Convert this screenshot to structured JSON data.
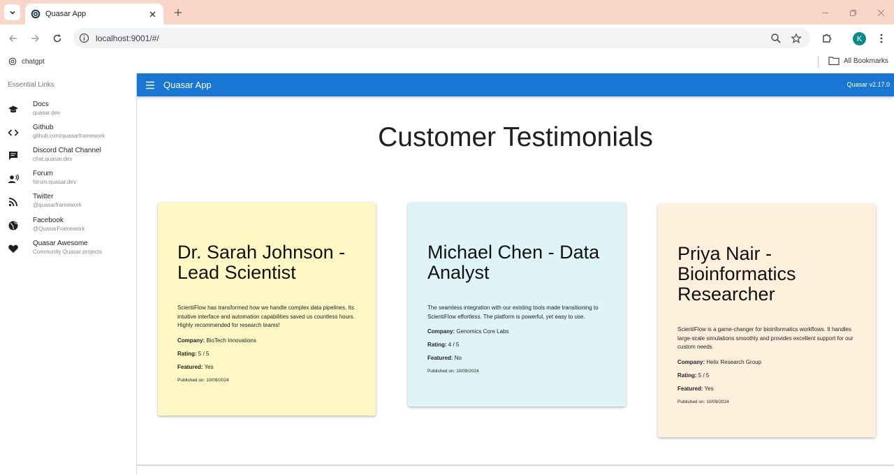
{
  "browser": {
    "tab_title": "Quasar App",
    "url": "localhost:9001/#/",
    "profile_initial": "K",
    "bookmarks": [
      {
        "label": "chatgpt"
      }
    ],
    "all_bookmarks_label": "All Bookmarks"
  },
  "drawer": {
    "header": "Essential Links",
    "links": [
      {
        "title": "Docs",
        "caption": "quasar.dev",
        "icon": "school-icon"
      },
      {
        "title": "Github",
        "caption": "github.com/quasarframework",
        "icon": "code-icon"
      },
      {
        "title": "Discord Chat Channel",
        "caption": "chat.quasar.dev",
        "icon": "chat-icon"
      },
      {
        "title": "Forum",
        "caption": "forum.quasar.dev",
        "icon": "record-voice-icon"
      },
      {
        "title": "Twitter",
        "caption": "@quasarframework",
        "icon": "rss-feed-icon"
      },
      {
        "title": "Facebook",
        "caption": "@QuasarFramework",
        "icon": "public-icon"
      },
      {
        "title": "Quasar Awesome",
        "caption": "Community Quasar projects",
        "icon": "favorite-icon"
      }
    ]
  },
  "header": {
    "title": "Quasar App",
    "version": "Quasar v2.17.0",
    "color": "#1976d2"
  },
  "page": {
    "heading": "Customer Testimonials"
  },
  "labels": {
    "company": "Company:",
    "rating": "Rating:",
    "featured": "Featured:",
    "published": "Published on:"
  },
  "testimonials": [
    {
      "name": "Dr. Sarah Johnson - Lead Scientist",
      "quote": "ScientiFlow has transformed how we handle complex data pipelines. Its intuitive interface and automation capabilities saved us countless hours. Highly recommended for research teams!",
      "company": "BioTech Innovations",
      "rating": "5 / 5",
      "featured": "Yes",
      "published": "10/09/2024",
      "bg": "#fff8c4"
    },
    {
      "name": "Michael Chen - Data Analyst",
      "quote": "The seamless integration with our existing tools made transitioning to ScientiFlow effortless. The platform is powerful, yet easy to use.",
      "company": "Genomics Core Labs",
      "rating": "4 / 5",
      "featured": "No",
      "published": "10/09/2024",
      "bg": "#dff4f7"
    },
    {
      "name": "Priya Nair - Bioinformatics Researcher",
      "quote": "ScientiFlow is a game-changer for bioinformatics workflows. It handles large-scale simulations smoothly and provides excellent support for our custom needs",
      "company": "Helix Research Group",
      "rating": "5 / 5",
      "featured": "Yes",
      "published": "10/09/2024",
      "bg": "#fff0de"
    }
  ]
}
